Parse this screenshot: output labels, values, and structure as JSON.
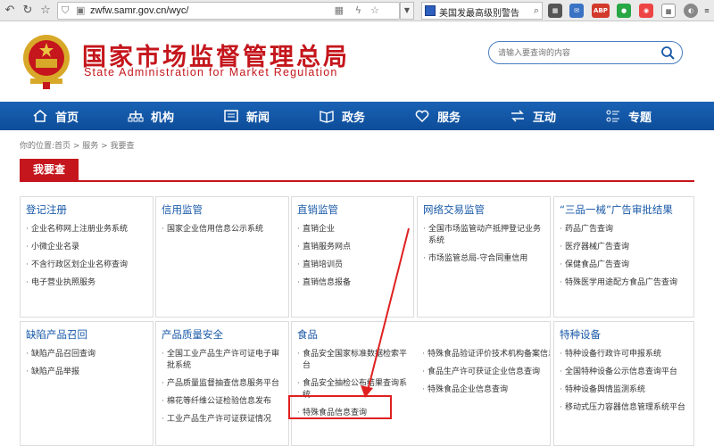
{
  "browser": {
    "url": "zwfw.samr.gov.cn/wyc/",
    "search_text": "美国发最高级别警告",
    "extensions": [
      "ABP"
    ]
  },
  "header": {
    "title_cn": "国家市场监督管理总局",
    "title_en": "State Administration for Market Regulation",
    "search_placeholder": "请输入要查询的内容"
  },
  "nav": {
    "items": [
      {
        "label": "首页",
        "icon": "home-icon"
      },
      {
        "label": "机构",
        "icon": "org-icon"
      },
      {
        "label": "新闻",
        "icon": "news-icon"
      },
      {
        "label": "政务",
        "icon": "affairs-icon"
      },
      {
        "label": "服务",
        "icon": "heart-icon"
      },
      {
        "label": "互动",
        "icon": "interact-icon"
      },
      {
        "label": "专题",
        "icon": "topic-icon"
      }
    ]
  },
  "breadcrumb": "你的位置:首页 > 服务 > 我要查",
  "section_title": "我要查",
  "cards": {
    "c1": {
      "title": "登记注册",
      "items": [
        "企业名称网上注册业务系统",
        "小微企业名录",
        "不含行政区划企业名称查询",
        "电子营业执照服务"
      ]
    },
    "c2": {
      "title": "信用监管",
      "items": [
        "国家企业信用信息公示系统"
      ]
    },
    "c3": {
      "title": "直销监管",
      "items": [
        "直销企业",
        "直销服务网点",
        "直销培训员",
        "直销信息报备"
      ]
    },
    "c4": {
      "title": "网络交易监管",
      "items": [
        "全国市场监管动产抵押登记业务系统",
        "市场监管总局-守合同重信用"
      ]
    },
    "c5": {
      "title": "“三品一械”广告审批结果",
      "items": [
        "药品广告查询",
        "医疗器械广告查询",
        "保健食品广告查询",
        "特殊医学用途配方食品广告查询"
      ]
    },
    "c6": {
      "title": "缺陷产品召回",
      "items": [
        "缺陷产品召回查询",
        "缺陷产品举报"
      ]
    },
    "c7": {
      "title": "产品质量安全",
      "items": [
        "全国工业产品生产许可证电子审批系统",
        "产品质量监督抽查信息服务平台",
        "棉花等纤维公证检验信息发布",
        "工业产品生产许可证获证情况"
      ]
    },
    "c8": {
      "title": "食品",
      "left": [
        "食品安全国家标准数据检索平台",
        "食品安全抽检公布结果查询系统",
        "特殊食品信息查询"
      ],
      "right": [
        "特殊食品验证评价技术机构备案信息系统",
        "食品生产许可获证企业信息查询",
        "特殊食品企业信息查询"
      ]
    },
    "c9": {
      "title": "特种设备",
      "items": [
        "特种设备行政许可申报系统",
        "全国特种设备公示信息查询平台",
        "特种设备舆情监测系统",
        "移动式压力容器信息管理系统平台"
      ]
    }
  }
}
